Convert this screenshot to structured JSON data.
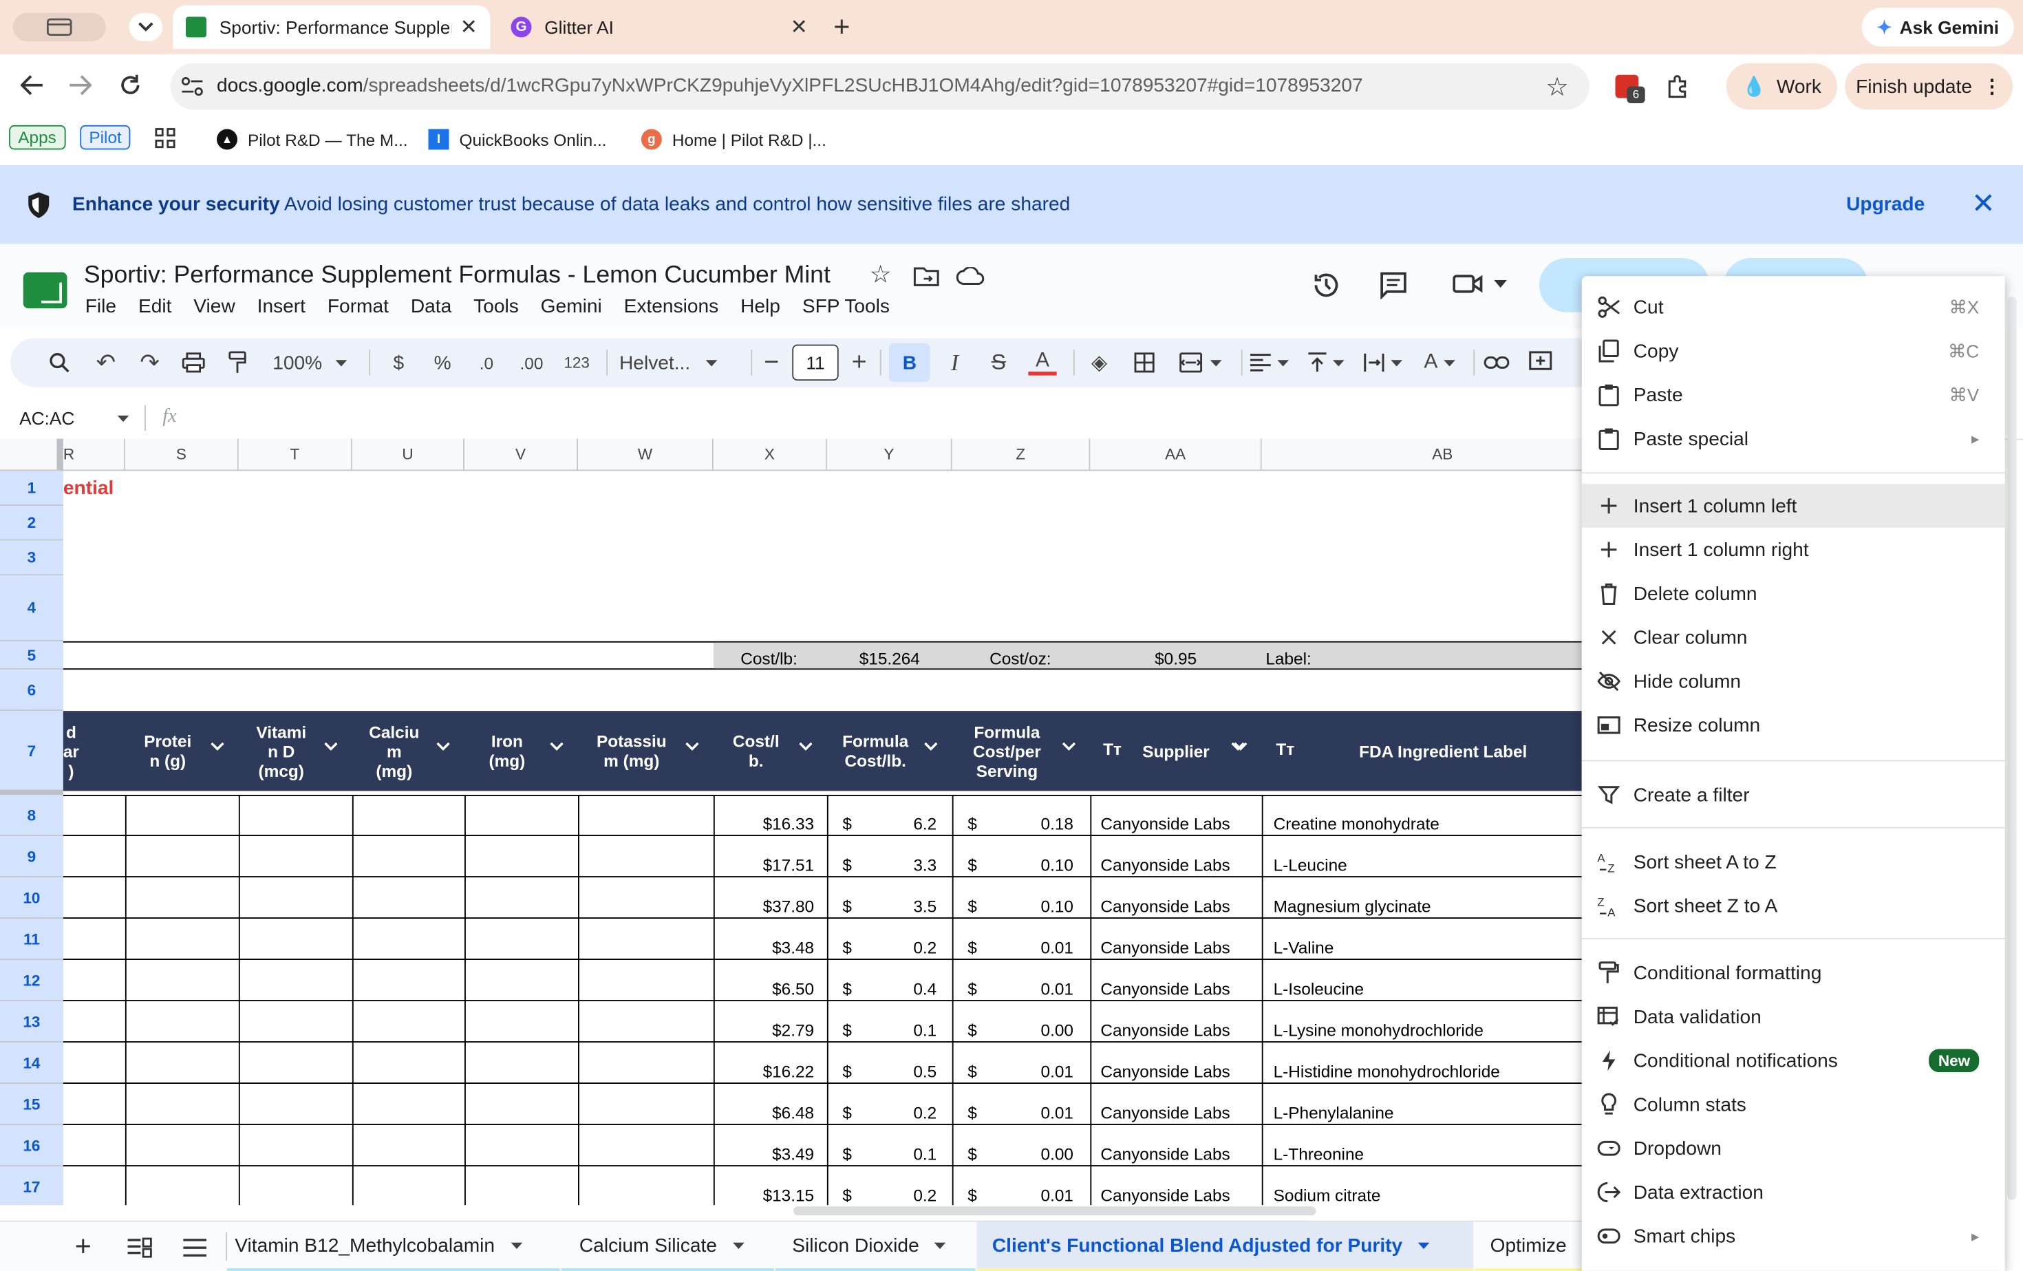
{
  "browser": {
    "tabs": [
      {
        "title": "Sportiv: Performance Supplem",
        "active": true
      },
      {
        "title": "Glitter AI",
        "active": false
      }
    ],
    "ask_gemini": "Ask Gemini",
    "url_domain": "docs.google.com",
    "url_path": "/spreadsheets/d/1wcRGpu7yNxWPrCKZ9puhjeVyXlPFL2SUcHBJ1OM4Ahg/edit?gid=1078953207#gid=1078953207",
    "extension_badge": "6",
    "profile_label": "Work",
    "finish_update": "Finish update",
    "bookmarks": [
      "Apps",
      "Pilot",
      "Pilot R&D — The M...",
      "QuickBooks Onlin...",
      "Home | Pilot R&D |..."
    ]
  },
  "banner": {
    "title": "Enhance your security",
    "text": "Avoid losing customer trust because of data leaks and control how sensitive files are shared",
    "upgrade": "Upgrade"
  },
  "doc": {
    "title": "Sportiv: Performance Supplement Formulas - Lemon Cucumber Mint",
    "menus": [
      "File",
      "Edit",
      "View",
      "Insert",
      "Format",
      "Data",
      "Tools",
      "Gemini",
      "Extensions",
      "Help",
      "SFP Tools"
    ]
  },
  "toolbar": {
    "zoom": "100%",
    "currency": "$",
    "percent": "%",
    "dec_decrease": ".0",
    "dec_increase": ".00",
    "number_format": "123",
    "font": "Helvet...",
    "font_size": "11"
  },
  "formula_bar": {
    "name_box": "AC:AC",
    "fx": "fx"
  },
  "grid": {
    "columns": [
      "R",
      "S",
      "T",
      "U",
      "V",
      "W",
      "X",
      "Y",
      "Z",
      "AA",
      "AB"
    ],
    "row_numbers": [
      "1",
      "2",
      "3",
      "4",
      "5",
      "6",
      "7",
      "8",
      "9",
      "10",
      "11",
      "12",
      "13",
      "14",
      "15",
      "16",
      "17"
    ],
    "r1_text": "ential",
    "r5": {
      "cost_lb_label": "Cost/lb:",
      "cost_lb_value": "$15.264",
      "cost_oz_label": "Cost/oz:",
      "cost_oz_value": "$0.95",
      "label_label": "Label:"
    },
    "headers": [
      {
        "col": "R",
        "text": "d\nar\n)"
      },
      {
        "col": "S",
        "text": "Protei\nn (g)"
      },
      {
        "col": "T",
        "text": "Vitami\nn D\n(mcg)"
      },
      {
        "col": "U",
        "text": "Calciu\nm\n(mg)"
      },
      {
        "col": "V",
        "text": "Iron\n(mg)"
      },
      {
        "col": "W",
        "text": "Potassiu\nm (mg)"
      },
      {
        "col": "X",
        "text": "Cost/l\nb."
      },
      {
        "col": "Y",
        "text": "Formula\nCost/lb."
      },
      {
        "col": "Z",
        "text": "Formula\nCost/per\nServing"
      },
      {
        "col": "AA",
        "text": "Supplier"
      },
      {
        "col": "AB",
        "text": "FDA Ingredient Label"
      }
    ],
    "rows": [
      {
        "cost_lb": "$16.33",
        "f_sym": "$",
        "f_cost": "6.2",
        "s_sym": "$",
        "s_cost": "0.18",
        "supplier": "Canyonside Labs",
        "label": "Creatine monohydrate"
      },
      {
        "cost_lb": "$17.51",
        "f_sym": "$",
        "f_cost": "3.3",
        "s_sym": "$",
        "s_cost": "0.10",
        "supplier": "Canyonside Labs",
        "label": "L-Leucine"
      },
      {
        "cost_lb": "$37.80",
        "f_sym": "$",
        "f_cost": "3.5",
        "s_sym": "$",
        "s_cost": "0.10",
        "supplier": "Canyonside Labs",
        "label": "Magnesium glycinate"
      },
      {
        "cost_lb": "$3.48",
        "f_sym": "$",
        "f_cost": "0.2",
        "s_sym": "$",
        "s_cost": "0.01",
        "supplier": "Canyonside Labs",
        "label": "L-Valine"
      },
      {
        "cost_lb": "$6.50",
        "f_sym": "$",
        "f_cost": "0.4",
        "s_sym": "$",
        "s_cost": "0.01",
        "supplier": "Canyonside Labs",
        "label": "L-Isoleucine"
      },
      {
        "cost_lb": "$2.79",
        "f_sym": "$",
        "f_cost": "0.1",
        "s_sym": "$",
        "s_cost": "0.00",
        "supplier": "Canyonside Labs",
        "label": "L-Lysine monohydrochloride"
      },
      {
        "cost_lb": "$16.22",
        "f_sym": "$",
        "f_cost": "0.5",
        "s_sym": "$",
        "s_cost": "0.01",
        "supplier": "Canyonside Labs",
        "label": "L-Histidine monohydrochloride"
      },
      {
        "cost_lb": "$6.48",
        "f_sym": "$",
        "f_cost": "0.2",
        "s_sym": "$",
        "s_cost": "0.01",
        "supplier": "Canyonside Labs",
        "label": "L-Phenylalanine"
      },
      {
        "cost_lb": "$3.49",
        "f_sym": "$",
        "f_cost": "0.1",
        "s_sym": "$",
        "s_cost": "0.00",
        "supplier": "Canyonside Labs",
        "label": "L-Threonine"
      },
      {
        "cost_lb": "$13.15",
        "f_sym": "$",
        "f_cost": "0.2",
        "s_sym": "$",
        "s_cost": "0.01",
        "supplier": "Canyonside Labs",
        "label": "Sodium citrate"
      }
    ]
  },
  "sheet_tabs": [
    "Vitamin B12_Methylcobalamin",
    "Calcium Silicate",
    "Silicon Dioxide",
    "Client's Functional Blend Adjusted for Purity",
    "Optimize"
  ],
  "context_menu": {
    "items": [
      {
        "label": "Cut",
        "shortcut": "⌘X",
        "icon": "scissors-icon"
      },
      {
        "label": "Copy",
        "shortcut": "⌘C",
        "icon": "copy-icon"
      },
      {
        "label": "Paste",
        "shortcut": "⌘V",
        "icon": "clipboard-icon"
      },
      {
        "label": "Paste special",
        "shortcut": "",
        "icon": "clipboard-icon"
      },
      {
        "label": "Insert 1 column left",
        "shortcut": "",
        "icon": "plus-icon"
      },
      {
        "label": "Insert 1 column right",
        "shortcut": "",
        "icon": "plus-icon"
      },
      {
        "label": "Delete column",
        "shortcut": "",
        "icon": "trash-icon"
      },
      {
        "label": "Clear column",
        "shortcut": "",
        "icon": "close-icon"
      },
      {
        "label": "Hide column",
        "shortcut": "",
        "icon": "eye-off-icon"
      },
      {
        "label": "Resize column",
        "shortcut": "",
        "icon": "resize-icon"
      },
      {
        "label": "Create a filter",
        "shortcut": "",
        "icon": "filter-icon"
      },
      {
        "label": "Sort sheet A to Z",
        "shortcut": "",
        "icon": "sort-az-icon"
      },
      {
        "label": "Sort sheet Z to A",
        "shortcut": "",
        "icon": "sort-za-icon"
      },
      {
        "label": "Conditional formatting",
        "shortcut": "",
        "icon": "paint-roller-icon"
      },
      {
        "label": "Data validation",
        "shortcut": "",
        "icon": "data-validation-icon"
      },
      {
        "label": "Conditional notifications",
        "shortcut": "",
        "icon": "bolt-icon"
      },
      {
        "label": "Column stats",
        "shortcut": "",
        "icon": "lightbulb-icon"
      },
      {
        "label": "Dropdown",
        "shortcut": "",
        "icon": "dropdown-chip-icon"
      },
      {
        "label": "Data extraction",
        "shortcut": "",
        "icon": "extract-icon"
      },
      {
        "label": "Smart chips",
        "shortcut": "",
        "icon": "chip-icon"
      }
    ],
    "new_badge": "New"
  },
  "colors": {
    "header_bg": "#2e3a59",
    "row_header_bg": "#d3e3fd",
    "banner_bg": "#d3e3fd",
    "accent": "#0b57d0",
    "confidential_red": "#e53935"
  }
}
